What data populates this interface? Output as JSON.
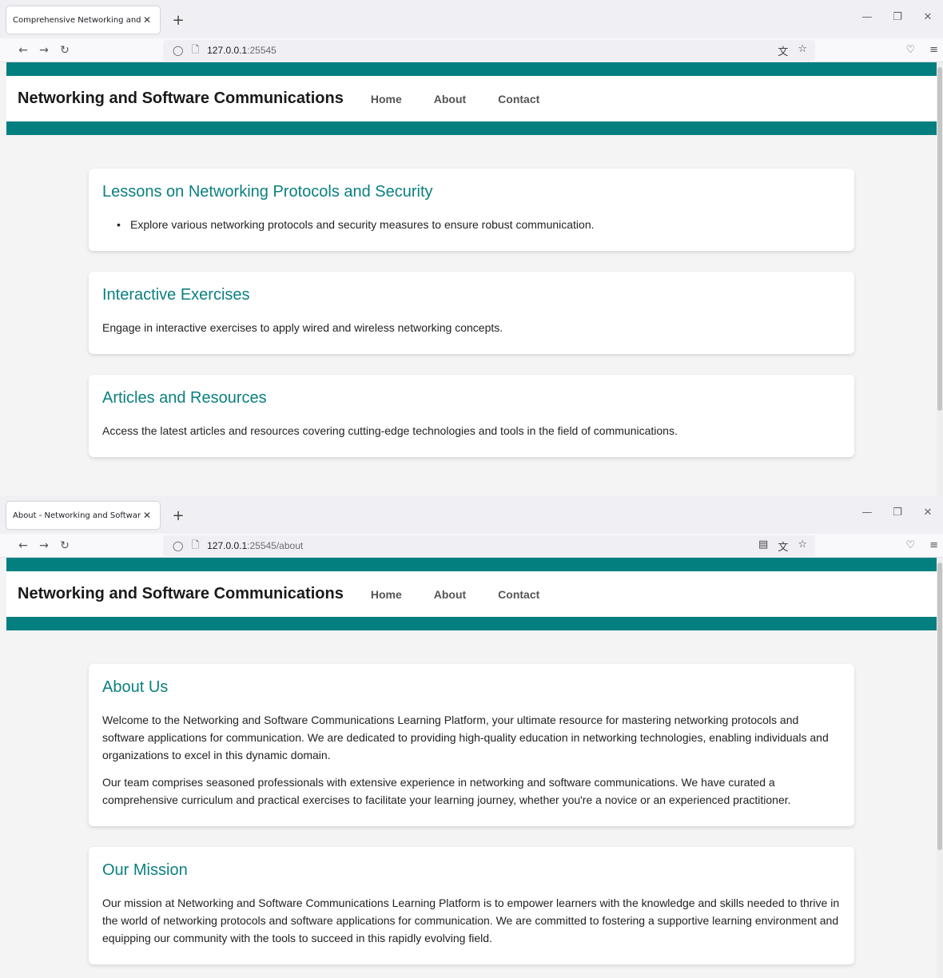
{
  "window1": {
    "tab_title": "Comprehensive Networking and Software Communications",
    "url_host": "127.0.0.1",
    "url_rest": ":25545",
    "site_title": "Networking and Software Communications",
    "nav": [
      "Home",
      "About",
      "Contact"
    ],
    "cards": [
      {
        "heading": "Lessons on Networking Protocols and Security",
        "bullet": "Explore various networking protocols and security measures to ensure robust communication."
      },
      {
        "heading": "Interactive Exercises",
        "text": "Engage in interactive exercises to apply wired and wireless networking concepts."
      },
      {
        "heading": "Articles and Resources",
        "text": "Access the latest articles and resources covering cutting-edge technologies and tools in the field of communications."
      }
    ]
  },
  "window2": {
    "tab_title": "About - Networking and Software Communications",
    "url_host": "127.0.0.1",
    "url_rest": ":25545/about",
    "site_title": "Networking and Software Communications",
    "nav": [
      "Home",
      "About",
      "Contact"
    ],
    "cards": [
      {
        "heading": "About Us",
        "paragraphs": [
          "Welcome to the Networking and Software Communications Learning Platform, your ultimate resource for mastering networking protocols and software applications for communication. We are dedicated to providing high-quality education in networking technologies, enabling individuals and organizations to excel in this dynamic domain.",
          "Our team comprises seasoned professionals with extensive experience in networking and software communications. We have curated a comprehensive curriculum and practical exercises to facilitate your learning journey, whether you're a novice or an experienced practitioner."
        ]
      },
      {
        "heading": "Our Mission",
        "paragraphs": [
          "Our mission at Networking and Software Communications Learning Platform is to empower learners with the knowledge and skills needed to thrive in the world of networking protocols and software applications for communication. We are committed to fostering a supportive learning environment and equipping our community with the tools to succeed in this rapidly evolving field."
        ]
      }
    ]
  },
  "icons": {
    "close": "✕",
    "new_tab": "+",
    "minimize": "—",
    "restore": "❐",
    "window_close": "✕",
    "back": "←",
    "forward": "→",
    "reload": "↻",
    "shield": "◯",
    "page": "🗋",
    "reader": "▤",
    "translate": "文",
    "star": "☆",
    "pocket": "♡",
    "menu": "≡"
  },
  "colors": {
    "accent": "#037f80",
    "heading": "#0b8080"
  }
}
